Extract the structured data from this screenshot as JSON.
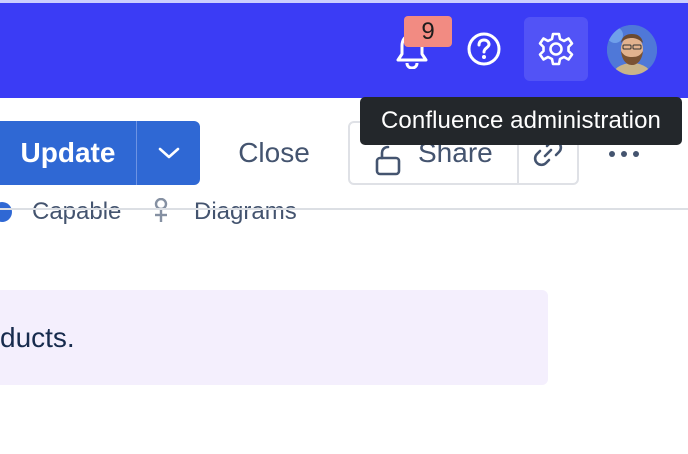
{
  "header": {
    "notifications_count": "9",
    "icons": [
      "bell-icon",
      "help-icon",
      "settings-icon",
      "avatar"
    ],
    "colors": {
      "bar": "#3b3cf5",
      "badge": "#f28b82"
    }
  },
  "tooltip": {
    "text": "Confluence administration"
  },
  "toolbar": {
    "update_label": "Update",
    "close_label": "Close",
    "share_label": "Share",
    "colors": {
      "primary": "#2f68d4"
    }
  },
  "labels": {
    "items": [
      "Capable",
      "Diagrams"
    ]
  },
  "content": {
    "panel_text": "ducts.",
    "panel_color": "#f4effd"
  }
}
